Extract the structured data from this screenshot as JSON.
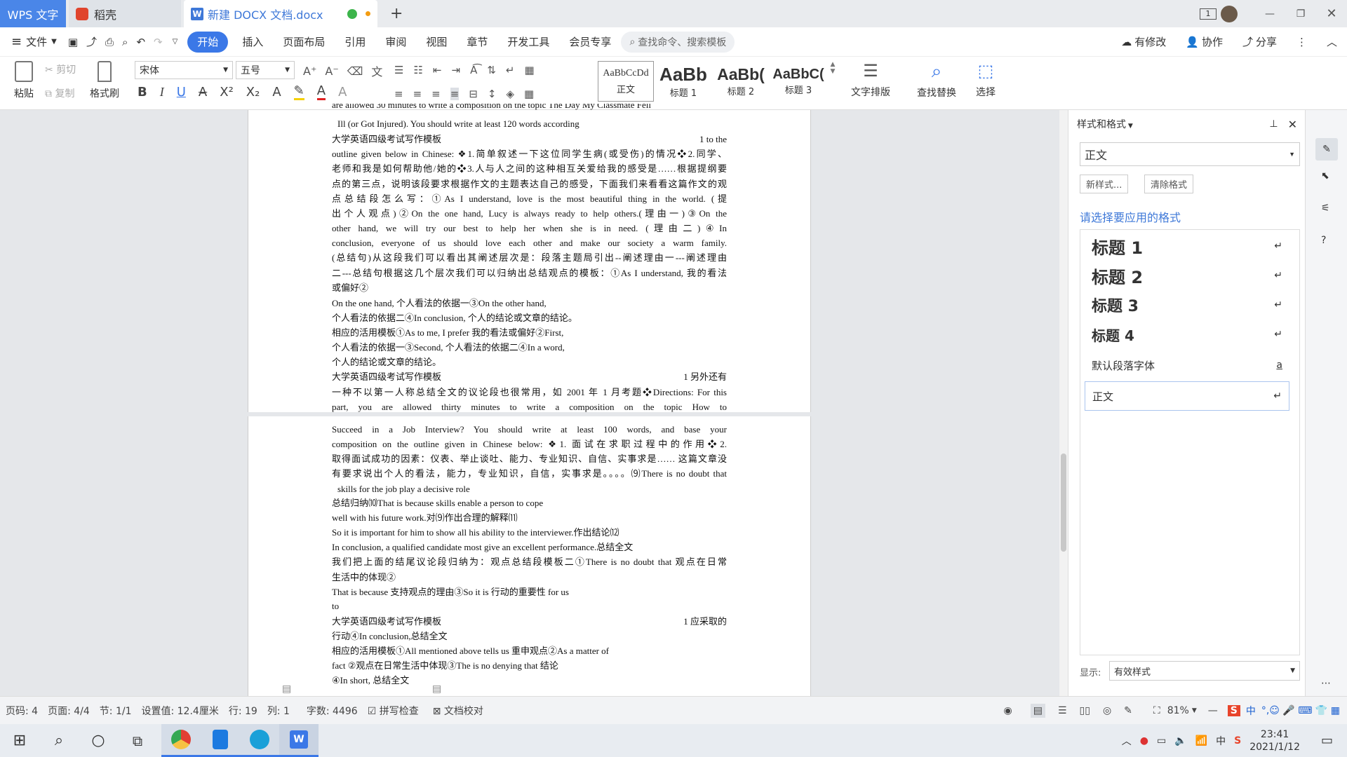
{
  "tabs": {
    "wps": "WPS 文字",
    "daoke": "稻壳",
    "doc": "新建 DOCX 文档.docx"
  },
  "window": {
    "badge": "1"
  },
  "menu": [
    "文件",
    "开始",
    "插入",
    "页面布局",
    "引用",
    "审阅",
    "视图",
    "章节",
    "开发工具",
    "会员专享"
  ],
  "search_placeholder": "查找命令、搜索模板",
  "menu_right": {
    "modified": "有修改",
    "collab": "协作",
    "share": "分享"
  },
  "toolbar": {
    "paste": "粘贴",
    "cut": "剪切",
    "copy": "复制",
    "format_painter": "格式刷",
    "font": "宋体",
    "size": "五号",
    "styles": [
      {
        "preview": "AaBbCcDd",
        "label": "正文"
      },
      {
        "preview": "AaBb",
        "label": "标题 1"
      },
      {
        "preview": "AaBb(",
        "label": "标题 2"
      },
      {
        "preview": "AaBbC(",
        "label": "标题 3"
      }
    ],
    "text_layout": "文字排版",
    "find_replace": "查找替换",
    "select": "选择"
  },
  "document_lines": [
    {
      "t": "are allowed 30 minutes to write a composition on the topic The Day My Classmate Fell",
      "cut": true
    },
    {
      "t": "Ill (or Got Injured). You should write at least 120 words according",
      "indent": true
    },
    {
      "t": "大学英语四级考试写作模板",
      "r": "1 to the"
    },
    {
      "t": "outline given below in Chinese: ❖1.简单叙述一下这位同学生病(或受伤)的情况❖2.同学、",
      "j": true
    },
    {
      "t": "老师和我是如何帮助他/她的❖3.人与人之间的这种相互关爱给我的感受是……根据提纲要",
      "j": true
    },
    {
      "t": "点的第三点，说明该段要求根据作文的主题表达自己的感受，下面我们来看看这篇作文的观",
      "j": true
    },
    {
      "t": "点总结段怎么写：①As I understand, love is the most beautiful thing in the world. (提",
      "j": true
    },
    {
      "t": "出个人观点)②On the one hand, Lucy is always ready to help others.(理由一)③On the",
      "j": true
    },
    {
      "t": "other hand, we will try our best to help her when she is in need. (理由二)④In",
      "j": true
    },
    {
      "t": "conclusion, everyone of us should love each other and make our society a warm family.",
      "j": true
    },
    {
      "t": "(总结句)从这段我们可以看出其阐述层次是：段落主题局引出--阐述理由一---阐述理由",
      "j": true
    },
    {
      "t": "二---总结句根据这几个层次我们可以归纳出总结观点的模板：①As I understand, 我的看法",
      "j": true
    },
    {
      "t": "或偏好②"
    },
    {
      "t": "On the one hand, 个人看法的依据一③On the other hand,"
    },
    {
      "t": "个人看法的依据二④In conclusion, 个人的结论或文章的结论。"
    },
    {
      "t": "相应的活用模板①As to me, I prefer 我的看法或偏好②First,"
    },
    {
      "t": "个人看法的依据一③Second, 个人看法的依据二④In a word,"
    },
    {
      "t": "个人的结论或文章的结论。"
    },
    {
      "t": "大学英语四级考试写作模板",
      "r": "1 另外还有"
    },
    {
      "t": "一种不以第一人称总结全文的议论段也很常用，如 2001 年 1 月考题❖Directions: For this",
      "j": true
    },
    {
      "t": "part, you are allowed thirty minutes to write a composition on the topic How to",
      "j": true
    },
    {
      "t": "Succeed in a Job Interview? You should write at least 100 words, and base your",
      "j": true
    },
    {
      "t": "composition on the outline given in Chinese below: ❖1. 面试在求职过程中的作用❖2.",
      "j": true
    },
    {
      "t": "取得面试成功的因素：仪表、举止谈吐、能力、专业知识、自信、实事求是…… 这篇文章没",
      "j": true
    },
    {
      "t": "有要求说出个人的看法，能力，专业知识，自信，实事求是。。。。⑼There is no doubt that",
      "j": true
    },
    {
      "t": "skills for the job play a decisive role",
      "indent": true
    },
    {
      "t": "总结归纳⑽That is because skills enable a person to cope"
    },
    {
      "t": "well with his future work.对⑼作出合理的解释⑾"
    },
    {
      "t": "So it is important for him to show all his ability to the interviewer.作出结论⑿"
    },
    {
      "t": "In conclusion, a qualified candidate most give an excellent performance.总结全文"
    },
    {
      "t": "我们把上面的结尾议论段归纳为：观点总结段模板二①There is no doubt that 观点在日常",
      "j": true
    },
    {
      "t": "生活中的体现②"
    },
    {
      "t": "That is because 支持观点的理由③So it is 行动的重要性 for us"
    },
    {
      "t": "to"
    },
    {
      "t": "大学英语四级考试写作模板",
      "r": "1 应采取的"
    },
    {
      "t": "行动④In conclusion,总结全文"
    },
    {
      "t": "相应的活用模板①All mentioned above tells us 重申观点②As a matter of"
    },
    {
      "t": "fact ②观点在日常生活中体现③The is no denying that 结论"
    },
    {
      "t": "④In short, 总结全文"
    }
  ],
  "panel": {
    "title": "样式和格式",
    "current": "正文",
    "new_style": "新样式...",
    "clear_format": "清除格式",
    "prompt": "请选择要应用的格式",
    "items": [
      "标题 1",
      "标题 2",
      "标题 3",
      "标题 4",
      "默认段落字体",
      "正文"
    ],
    "default_font_mark": "a",
    "show_label": "显示:",
    "show_value": "有效样式"
  },
  "status": {
    "page": "页码: 4",
    "pages": "页面: 4/4",
    "section": "节: 1/1",
    "setting": "设置值: 12.4厘米",
    "row": "行: 19",
    "col": "列: 1",
    "words": "字数: 4496",
    "spell": "拼写检查",
    "proof": "文档校对",
    "zoom": "81%"
  },
  "ime": "中",
  "clock": {
    "time": "23:41",
    "date": "2021/1/12"
  },
  "colors": {
    "accent": "#3b78e7",
    "wps_tab": "#4a86e8",
    "heading_link": "#3e78d8"
  }
}
